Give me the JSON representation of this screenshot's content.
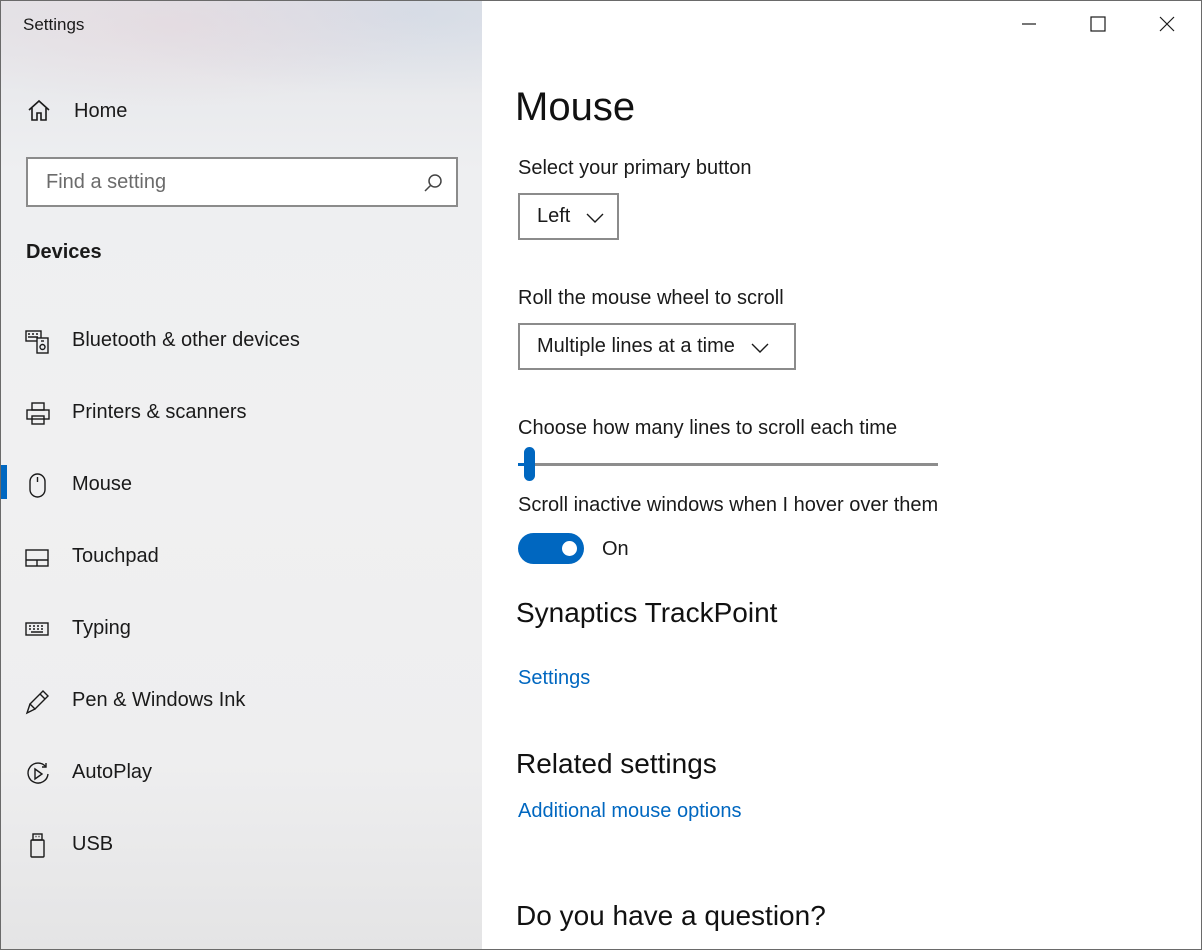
{
  "window": {
    "title": "Settings",
    "controls": {
      "minimize_icon": "minimize-icon",
      "maximize_icon": "maximize-icon",
      "close_icon": "close-icon"
    }
  },
  "sidebar": {
    "home": {
      "label": "Home",
      "icon": "home-icon"
    },
    "search": {
      "placeholder": "Find a setting",
      "value": "",
      "icon": "search-icon"
    },
    "section_label": "Devices",
    "items": [
      {
        "label": "Bluetooth & other devices",
        "icon": "bluetooth-devices-icon",
        "selected": false
      },
      {
        "label": "Printers & scanners",
        "icon": "printer-icon",
        "selected": false
      },
      {
        "label": "Mouse",
        "icon": "mouse-icon",
        "selected": true
      },
      {
        "label": "Touchpad",
        "icon": "touchpad-icon",
        "selected": false
      },
      {
        "label": "Typing",
        "icon": "keyboard-icon",
        "selected": false
      },
      {
        "label": "Pen & Windows Ink",
        "icon": "pen-icon",
        "selected": false
      },
      {
        "label": "AutoPlay",
        "icon": "autoplay-icon",
        "selected": false
      },
      {
        "label": "USB",
        "icon": "usb-icon",
        "selected": false
      }
    ]
  },
  "main": {
    "title": "Mouse",
    "primary_button": {
      "label": "Select your primary button",
      "value": "Left"
    },
    "wheel_scroll": {
      "label": "Roll the mouse wheel to scroll",
      "value": "Multiple lines at a time"
    },
    "lines_slider": {
      "label": "Choose how many lines to scroll each time",
      "value": 3,
      "min": 1,
      "max": 100
    },
    "inactive_scroll": {
      "label": "Scroll inactive windows when I hover over them",
      "state_label": "On",
      "on": true
    },
    "trackpoint": {
      "heading": "Synaptics TrackPoint",
      "link": "Settings"
    },
    "related": {
      "heading": "Related settings",
      "link": "Additional mouse options"
    },
    "question": {
      "heading": "Do you have a question?"
    }
  },
  "colors": {
    "accent": "#0067c0",
    "sidebar_bg": "#efeff0",
    "text": "#1a1a1a",
    "border": "#8b8b8b"
  }
}
